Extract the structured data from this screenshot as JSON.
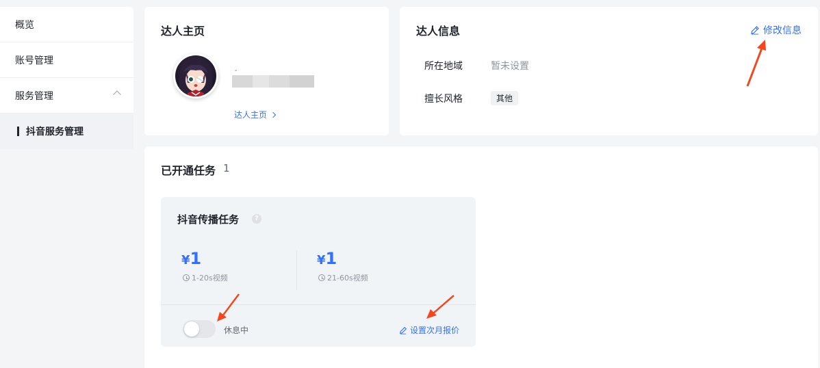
{
  "sidebar": {
    "items": [
      {
        "label": "概览"
      },
      {
        "label": "账号管理"
      },
      {
        "label": "服务管理"
      },
      {
        "label": "抖音服务管理"
      }
    ]
  },
  "home_card": {
    "title": "达人主页",
    "link_label": "达人主页"
  },
  "info_card": {
    "title": "达人信息",
    "edit_label": "修改信息",
    "region_label": "所在地域",
    "region_value": "暂未设置",
    "style_label": "擅长风格",
    "style_tag": "其他"
  },
  "tasks": {
    "title": "已开通任务",
    "count": "1",
    "task": {
      "name": "抖音传播任务",
      "help": "?",
      "prices": [
        {
          "currency": "¥",
          "amount": "1",
          "duration": "1-20s视频"
        },
        {
          "currency": "¥",
          "amount": "1",
          "duration": "21-60s视频"
        }
      ],
      "toggle_state": "休息中",
      "toggle_on": false,
      "set_price_label": "设置次月报价"
    }
  },
  "colors": {
    "accent": "#3370ff",
    "annotation_arrow": "#f5461e"
  },
  "icons": [
    "chevron-up-icon",
    "chevron-right-icon",
    "edit-icon",
    "help-icon",
    "clock-icon"
  ]
}
